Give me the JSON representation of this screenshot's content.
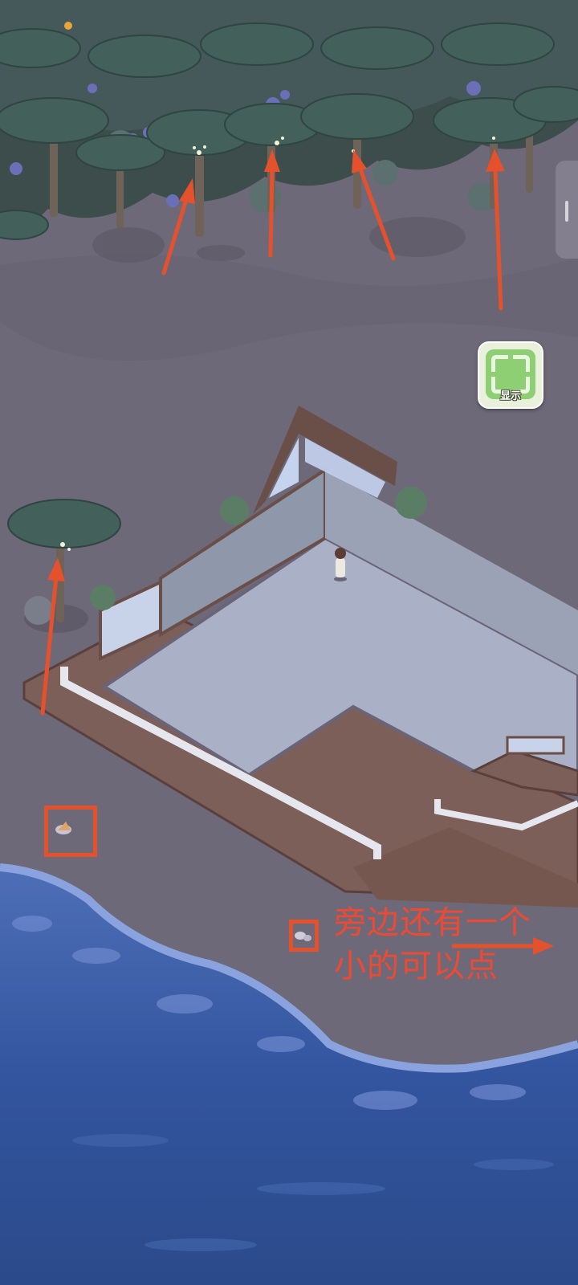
{
  "show_button": {
    "label": "显示",
    "icon": "expand-frame-icon"
  },
  "annotation": {
    "line1": "旁边还有一个",
    "line2": "小的可以点",
    "color": "#e9553a"
  },
  "colors": {
    "sand": "#6f6a78",
    "water_deep": "#2f5aa8",
    "palm": "#3f5a52",
    "deck_wood": "#7d5f5a",
    "floor": "#aab0c6",
    "arrow": "#e5512d"
  }
}
